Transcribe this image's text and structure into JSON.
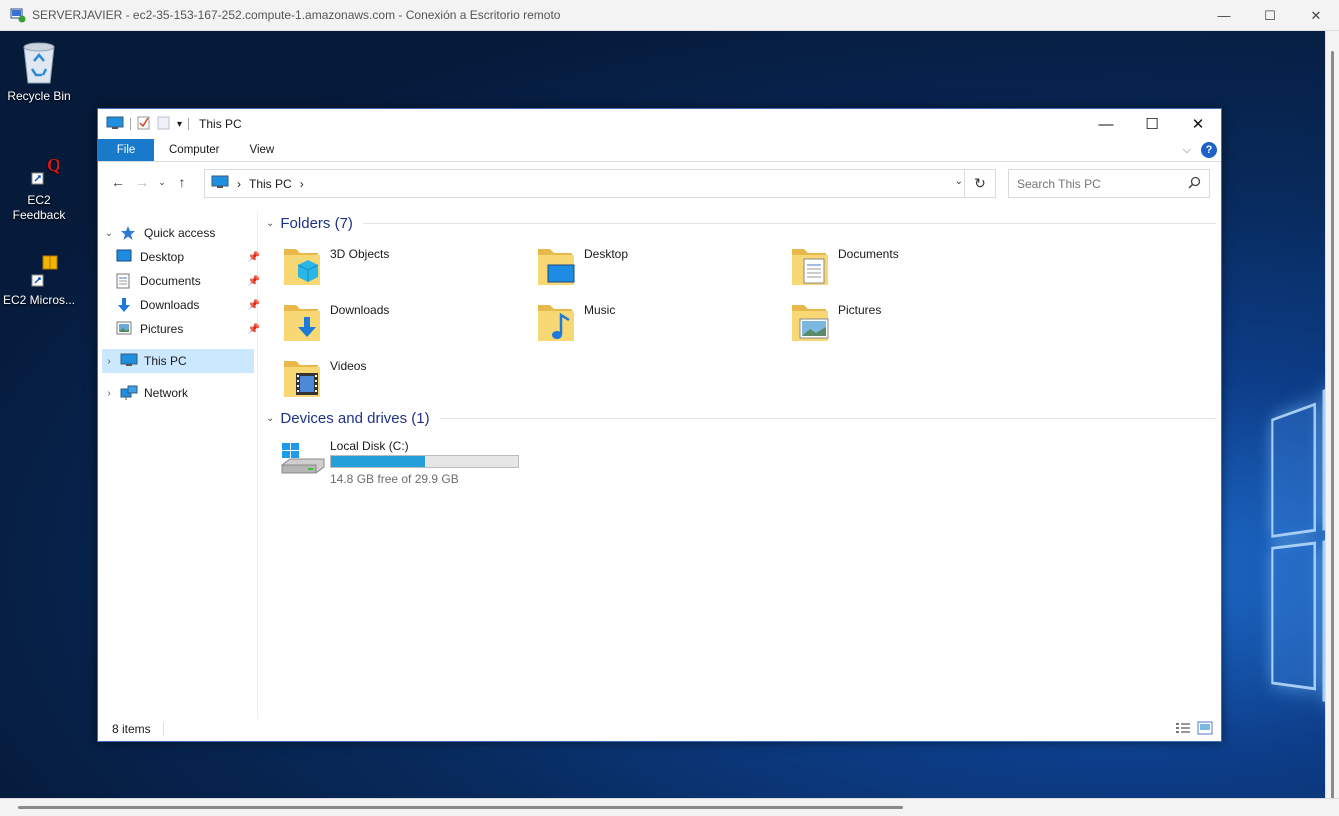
{
  "rdp": {
    "title": "SERVERJAVIER - ec2-35-153-167-252.compute-1.amazonaws.com - Conexión a Escritorio remoto",
    "minimize": "—",
    "maximize": "☐",
    "close": "✕"
  },
  "desktop": {
    "icons": [
      {
        "label": "Recycle Bin",
        "icon": "recycle-bin-icon"
      },
      {
        "label": "EC2 Feedback",
        "icon": "feedback-q-icon"
      },
      {
        "label": "EC2 Micros...",
        "icon": "ec2-package-icon"
      }
    ]
  },
  "explorer": {
    "title": "This PC",
    "controls": {
      "minimize": "—",
      "maximize": "☐",
      "close": "✕"
    },
    "ribbon": {
      "tabs": [
        {
          "label": "File",
          "active": true
        },
        {
          "label": "Computer"
        },
        {
          "label": "View"
        }
      ],
      "help": "?"
    },
    "address": {
      "path": [
        "This PC"
      ],
      "search_placeholder": "Search This PC"
    },
    "nav": {
      "quick_access": "Quick access",
      "items": [
        {
          "label": "Desktop",
          "pinned": true,
          "icon": "desktop-icon"
        },
        {
          "label": "Documents",
          "pinned": true,
          "icon": "documents-icon"
        },
        {
          "label": "Downloads",
          "pinned": true,
          "icon": "downloads-icon"
        },
        {
          "label": "Pictures",
          "pinned": true,
          "icon": "pictures-icon"
        }
      ],
      "this_pc": "This PC",
      "network": "Network"
    },
    "folders_header": "Folders (7)",
    "folders": [
      {
        "name": "3D Objects",
        "icon": "3d-objects-folder-icon"
      },
      {
        "name": "Desktop",
        "icon": "desktop-folder-icon"
      },
      {
        "name": "Documents",
        "icon": "documents-folder-icon"
      },
      {
        "name": "Downloads",
        "icon": "downloads-folder-icon"
      },
      {
        "name": "Music",
        "icon": "music-folder-icon"
      },
      {
        "name": "Pictures",
        "icon": "pictures-folder-icon"
      },
      {
        "name": "Videos",
        "icon": "videos-folder-icon"
      }
    ],
    "devices_header": "Devices and drives (1)",
    "drive": {
      "name": "Local Disk (C:)",
      "free_text": "14.8 GB free of 29.9 GB",
      "used_fraction": 0.505,
      "bar_color": "#26a0da"
    },
    "status": {
      "items": "8 items"
    }
  }
}
